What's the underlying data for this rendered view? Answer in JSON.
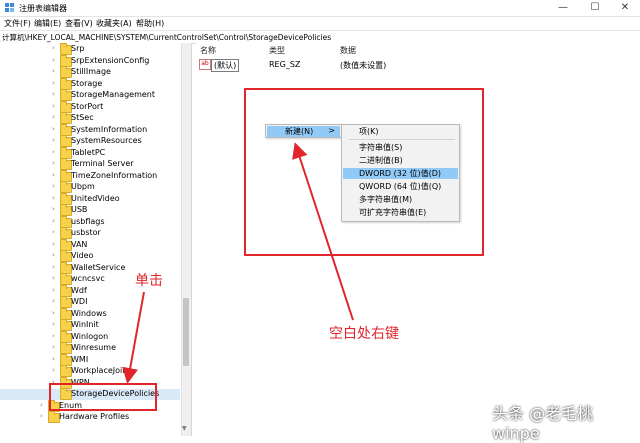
{
  "window": {
    "title": "注册表编辑器",
    "minimize": "—",
    "maximize": "☐",
    "close": "✕",
    "icon": "registry-icon"
  },
  "menu": [
    "文件(F)",
    "编辑(E)",
    "查看(V)",
    "收藏夹(A)",
    "帮助(H)"
  ],
  "address": "计算机\\HKEY_LOCAL_MACHINE\\SYSTEM\\CurrentControlSet\\Control\\StorageDevicePolicies",
  "tree": [
    "Srp",
    "SrpExtensionConfig",
    "StillImage",
    "Storage",
    "StorageManagement",
    "StorPort",
    "StSec",
    "SystemInformation",
    "SystemResources",
    "TabletPC",
    "Terminal Server",
    "TimeZoneInformation",
    "Ubpm",
    "UnitedVideo",
    "USB",
    "usbflags",
    "usbstor",
    "VAN",
    "Video",
    "WalletService",
    "wcncsvc",
    "Wdf",
    "WDI",
    "Windows",
    "WinInit",
    "Winlogon",
    "Winresume",
    "WMI",
    "WorkplaceJoin",
    "WPN",
    "StorageDevicePolicies",
    "Enum",
    "Hardware Profiles"
  ],
  "values": {
    "headers": [
      "名称",
      "类型",
      "数据"
    ],
    "row": {
      "name": "(默认)",
      "type": "REG_SZ",
      "data": "(数值未设置)"
    }
  },
  "context_menu": {
    "new_label": "新建(N)",
    "arrow": ">",
    "submenu": [
      "项(K)",
      "字符串值(S)",
      "二进制值(B)",
      "DWORD (32 位)值(D)",
      "QWORD (64 位)值(Q)",
      "多字符串值(M)",
      "可扩充字符串值(E)"
    ],
    "selected_index": 3
  },
  "annotations": {
    "click": "单击",
    "blank_right_click": "空白处右键"
  },
  "watermark": "头条 @老毛桃winpe",
  "colors": {
    "highlight": "#e0252b",
    "selection": "#91c9f7",
    "folder": "#f6d24c"
  }
}
